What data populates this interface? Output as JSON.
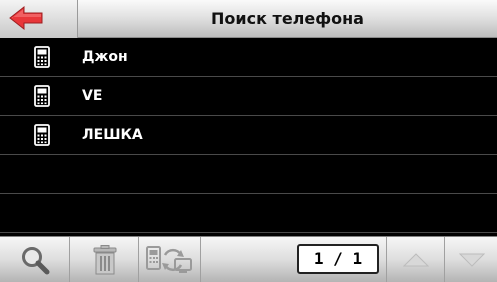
{
  "header": {
    "title": "Поиск телефона",
    "back_icon": "back-arrow-icon",
    "accent_color": "#e8373a"
  },
  "contacts": [
    {
      "label": "Джон",
      "icon": "mobile-phone-icon"
    },
    {
      "label": "VE",
      "icon": "mobile-phone-icon"
    },
    {
      "label": "ЛЕШКА",
      "icon": "mobile-phone-icon"
    }
  ],
  "toolbar": {
    "search_icon": "search-icon",
    "delete_icon": "trash-icon",
    "sync_icon": "phone-sync-icon",
    "page_indicator": "1 / 1",
    "up_icon": "arrow-up-icon",
    "down_icon": "arrow-down-icon"
  }
}
